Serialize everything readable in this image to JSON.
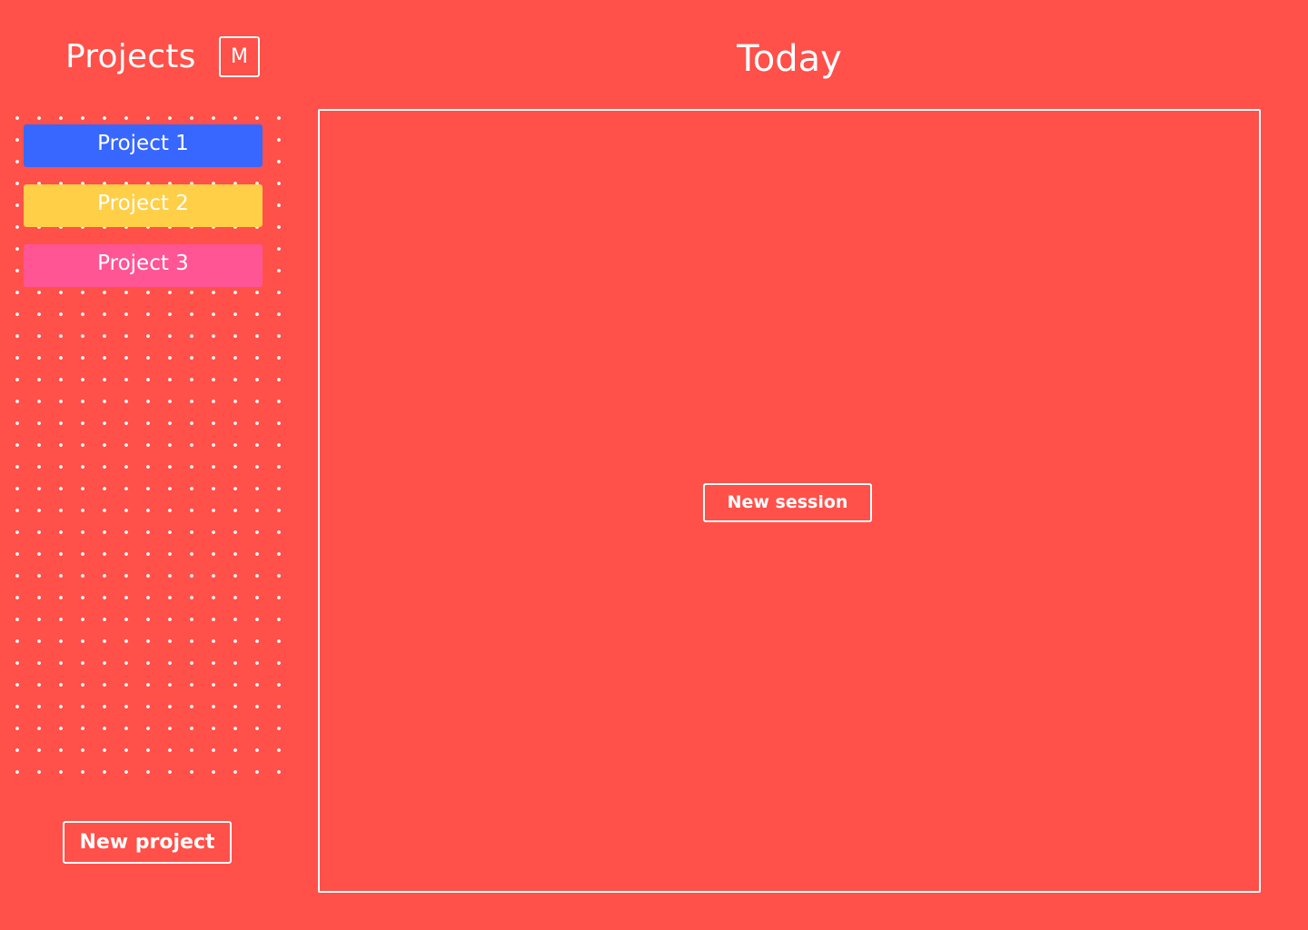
{
  "colors": {
    "background": "#FF5049",
    "foreground": "#FFFFFF"
  },
  "sidebar": {
    "title": "Projects",
    "menu_button_label": "M",
    "projects": [
      {
        "label": "Project 1",
        "color": "#3867FF"
      },
      {
        "label": "Project 2",
        "color": "#FFCF48"
      },
      {
        "label": "Project 3",
        "color": "#FF5595"
      }
    ],
    "new_project_label": "New project"
  },
  "main": {
    "title": "Today",
    "new_session_label": "New session"
  }
}
